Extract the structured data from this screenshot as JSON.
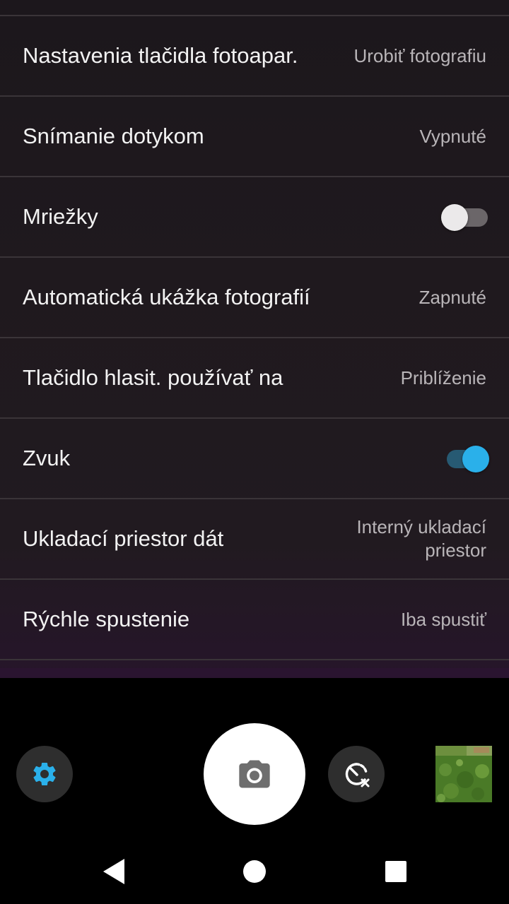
{
  "settings": {
    "rows": [
      {
        "label": "Nastavenia tlačidla fotoapar.",
        "value": "Urobiť fotografiu"
      },
      {
        "label": "Snímanie dotykom",
        "value": "Vypnuté"
      },
      {
        "label": "Mriežky",
        "toggle": "off"
      },
      {
        "label": "Automatická ukážka fotografií",
        "value": "Zapnuté"
      },
      {
        "label": "Tlačidlo hlasit. používať na",
        "value": "Priblíženie"
      },
      {
        "label": "Zvuk",
        "toggle": "on"
      },
      {
        "label": "Ukladací priestor dát",
        "value": "Interný ukladací priestor"
      },
      {
        "label": "Rýchle spustenie",
        "value": "Iba spustiť"
      }
    ]
  },
  "camera_bar": {
    "settings_icon": "gear-icon",
    "shutter_icon": "camera-icon",
    "timer_icon": "timer-off-icon",
    "thumbnail": "last-photo-thumbnail"
  },
  "nav": {
    "back_icon": "back-triangle-icon",
    "home_icon": "home-circle-icon",
    "recents_icon": "recents-square-icon"
  },
  "colors": {
    "accent": "#2ab0ea",
    "toggle_on_track": "#275a73",
    "text_primary": "#f2f2f2",
    "text_secondary": "#b9b5b8"
  }
}
